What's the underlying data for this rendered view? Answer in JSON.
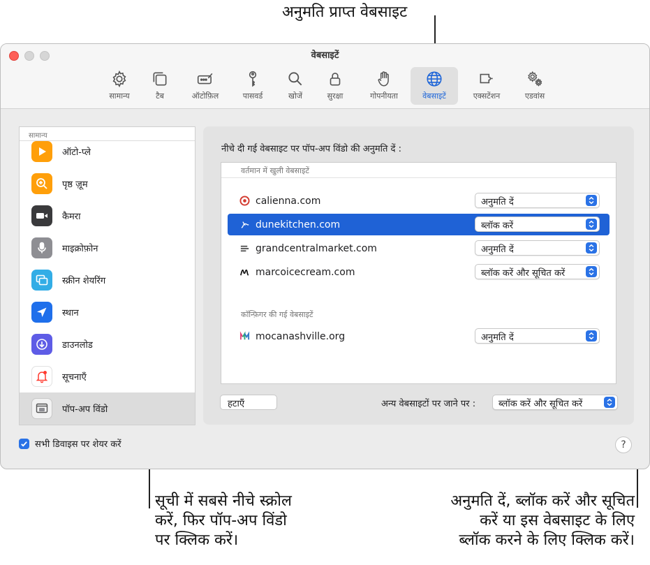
{
  "callouts": {
    "top": "अनुमति प्राप्त वेबसाइट",
    "bottom_left": [
      "सूची में सबसे नीचे स्क्रोल",
      "करें, फिर पॉप-अप विंडो",
      "पर क्लिक करें।"
    ],
    "bottom_right": [
      "अनुमति दें, ब्लॉक करें और सूचित",
      "करें या इस वेबसाइट के लिए",
      "ब्लॉक करने के लिए क्लिक करें।"
    ]
  },
  "window": {
    "title": "वेबसाइटें"
  },
  "toolbar": {
    "tabs": [
      {
        "label": "सामान्य",
        "icon": "gear-icon"
      },
      {
        "label": "टैब",
        "icon": "tabs-icon"
      },
      {
        "label": "ऑटोफ़िल",
        "icon": "autofill-icon"
      },
      {
        "label": "पासवर्ड",
        "icon": "key-icon"
      },
      {
        "label": "खोजें",
        "icon": "search-icon"
      },
      {
        "label": "सुरक्षा",
        "icon": "lock-icon"
      },
      {
        "label": "गोपनीयता",
        "icon": "hand-icon"
      },
      {
        "label": "वेबसाइटें",
        "icon": "globe-icon"
      },
      {
        "label": "एक्सटेंशन",
        "icon": "extension-icon"
      },
      {
        "label": "एडवांस",
        "icon": "gears-icon"
      }
    ],
    "active_index": 7
  },
  "sidebar": {
    "section": "सामान्य",
    "items": [
      {
        "label": "ऑटो-प्ले",
        "icon": "play-icon",
        "color": "#ff9f0a"
      },
      {
        "label": "पृष्ठ ज़ूम",
        "icon": "zoom-icon",
        "color": "#ff9f0a"
      },
      {
        "label": "कैमरा",
        "icon": "camera-icon",
        "color": "#3a3a3c"
      },
      {
        "label": "माइक्रोफ़ोन",
        "icon": "microphone-icon",
        "color": "#8e8e93"
      },
      {
        "label": "स्क्रीन शेयरिंग",
        "icon": "screen-sharing-icon",
        "color": "#32ade6"
      },
      {
        "label": "स्थान",
        "icon": "location-icon",
        "color": "#1f6feb"
      },
      {
        "label": "डाउनलोड",
        "icon": "download-icon",
        "color": "#5e5ce6"
      },
      {
        "label": "सूचनाएँ",
        "icon": "notification-icon",
        "color": "#ff3b30"
      },
      {
        "label": "पॉप-अप विंडो",
        "icon": "popup-window-icon",
        "color": "#8e8e93"
      }
    ],
    "selected_index": 8
  },
  "share": {
    "label": "सभी डिवाइस पर शेयर करें",
    "checked": true
  },
  "help": {
    "label": "?"
  },
  "panel": {
    "title": "नीचे दी गई वेबसाइट पर पॉप-अप विंडो की अनुमति दें :",
    "open_header": "वर्तमान में खुली वेबसाइटें",
    "open_sites": [
      {
        "name": "calienna.com",
        "setting": "अनुमति दें",
        "icon": "calienna-icon"
      },
      {
        "name": "dunekitchen.com",
        "setting": "ब्लॉक करें",
        "icon": "dunekitchen-icon"
      },
      {
        "name": "grandcentralmarket.com",
        "setting": "अनुमति दें",
        "icon": "grandcentral-icon"
      },
      {
        "name": "marcoicecream.com",
        "setting": "ब्लॉक करें और सूचित करें",
        "icon": "marco-icon"
      }
    ],
    "selected_site_index": 1,
    "configured_header": "कॉन्फ़िगर की गई वेबसाइटें",
    "configured_sites": [
      {
        "name": "mocanashville.org",
        "setting": "अनुमति दें",
        "icon": "moca-icon"
      }
    ],
    "remove_button": "हटाएँ",
    "other_label": "अन्य वेबसाइटों पर जाने पर :",
    "other_setting": "ब्लॉक करें और सूचित करें"
  }
}
